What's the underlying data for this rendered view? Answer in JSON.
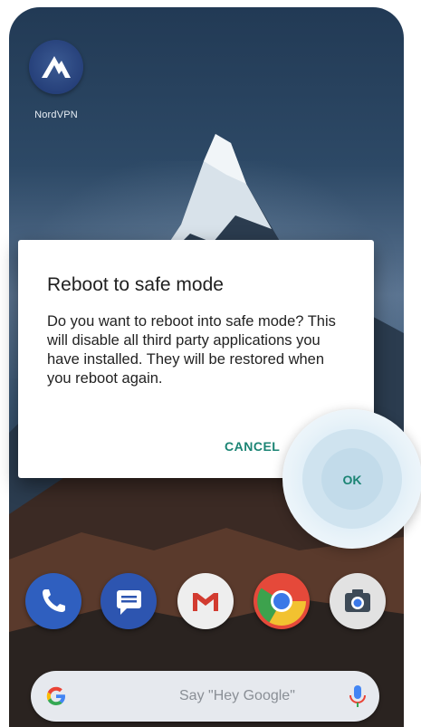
{
  "home": {
    "app_label": "NordVPN",
    "app_icon": "nordvpn-mountain-icon"
  },
  "dialog": {
    "title": "Reboot to safe mode",
    "body": "Do you want to reboot into safe mode? This will disable all third party applications you have installed. They will be restored when you reboot again.",
    "cancel_label": "CANCEL",
    "ok_label": "OK",
    "accent_color": "#1b8474"
  },
  "dock": {
    "apps": [
      "phone-icon",
      "messages-icon",
      "gmail-icon",
      "chrome-icon",
      "camera-icon"
    ]
  },
  "search": {
    "logo": "google-g-icon",
    "hint": "Say \"Hey Google\"",
    "mic": "mic-icon"
  }
}
